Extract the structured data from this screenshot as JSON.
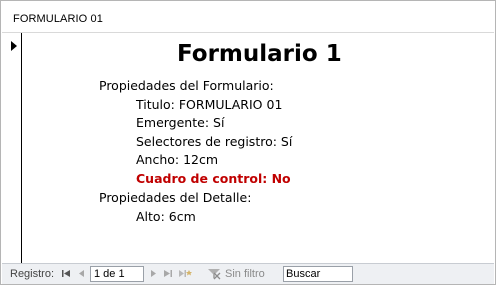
{
  "window": {
    "title": "FORMULARIO 01"
  },
  "form": {
    "heading": "Formulario 1",
    "lines": [
      "Propiedades del Formulario:",
      "Titulo: FORMULARIO 01",
      "Emergente: Sí",
      "Selectores de registro: Sí",
      "Ancho: 12cm",
      "Cuadro de control: No",
      "Propiedades del Detalle:",
      "Alto: 6cm"
    ],
    "highlight_color": "#c00000"
  },
  "navigation": {
    "label": "Registro:",
    "record_counter": "1 de 1",
    "filter_label": "Sin filtro",
    "search_value": "Buscar",
    "icons": [
      "first-record-icon",
      "previous-record-icon",
      "next-record-icon",
      "last-record-icon",
      "new-record-icon",
      "filter-icon"
    ]
  }
}
